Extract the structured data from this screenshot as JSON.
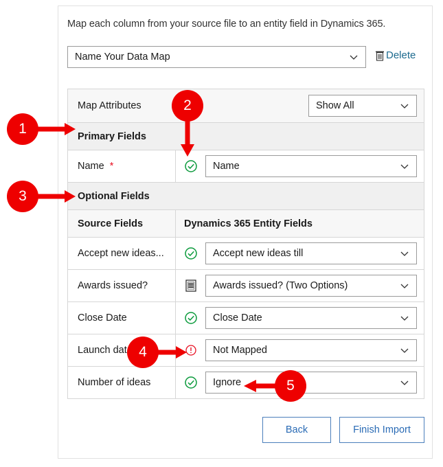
{
  "dialog": {
    "intro_text": "Map each column from your source file to an entity field in Dynamics 365.",
    "map_name": {
      "value": "Name Your Data Map",
      "icon": "chevron-down-icon"
    },
    "delete": {
      "label": "Delete",
      "icon": "trash-icon"
    },
    "map_attributes": {
      "label": "Map Attributes",
      "filter_value": "Show All",
      "filter_icon": "chevron-down-icon"
    },
    "sections": {
      "primary_fields": "Primary Fields",
      "optional_fields": "Optional Fields"
    },
    "column_headers": {
      "source": "Source Fields",
      "target": "Dynamics 365 Entity Fields"
    },
    "primary_rows": [
      {
        "source": "Name",
        "required_marker": "*",
        "status_icon": "green-check-circle-icon",
        "target": "Name"
      }
    ],
    "optional_rows": [
      {
        "source": "Accept new ideas...",
        "status_icon": "green-check-circle-icon",
        "target": "Accept new ideas till"
      },
      {
        "source": "Awards issued?",
        "status_icon": "list-document-icon",
        "target": "Awards issued? (Two Options)"
      },
      {
        "source": "Close Date",
        "status_icon": "green-check-circle-icon",
        "target": "Close Date"
      },
      {
        "source": "Launch date",
        "status_icon": "red-warning-circle-icon",
        "target": "Not Mapped"
      },
      {
        "source": "Number of ideas",
        "status_icon": "green-check-circle-icon",
        "target": "Ignore"
      }
    ],
    "footer": {
      "back_label": "Back",
      "finish_label": "Finish Import"
    }
  },
  "annotations": {
    "badges": [
      {
        "number": "1",
        "points_to": "Primary Fields section header"
      },
      {
        "number": "2",
        "points_to": "Name row status check icon"
      },
      {
        "number": "3",
        "points_to": "Optional Fields section header"
      },
      {
        "number": "4",
        "points_to": "Launch date warning icon"
      },
      {
        "number": "5",
        "points_to": "Ignore target value"
      }
    ],
    "color": "#ee0000"
  }
}
